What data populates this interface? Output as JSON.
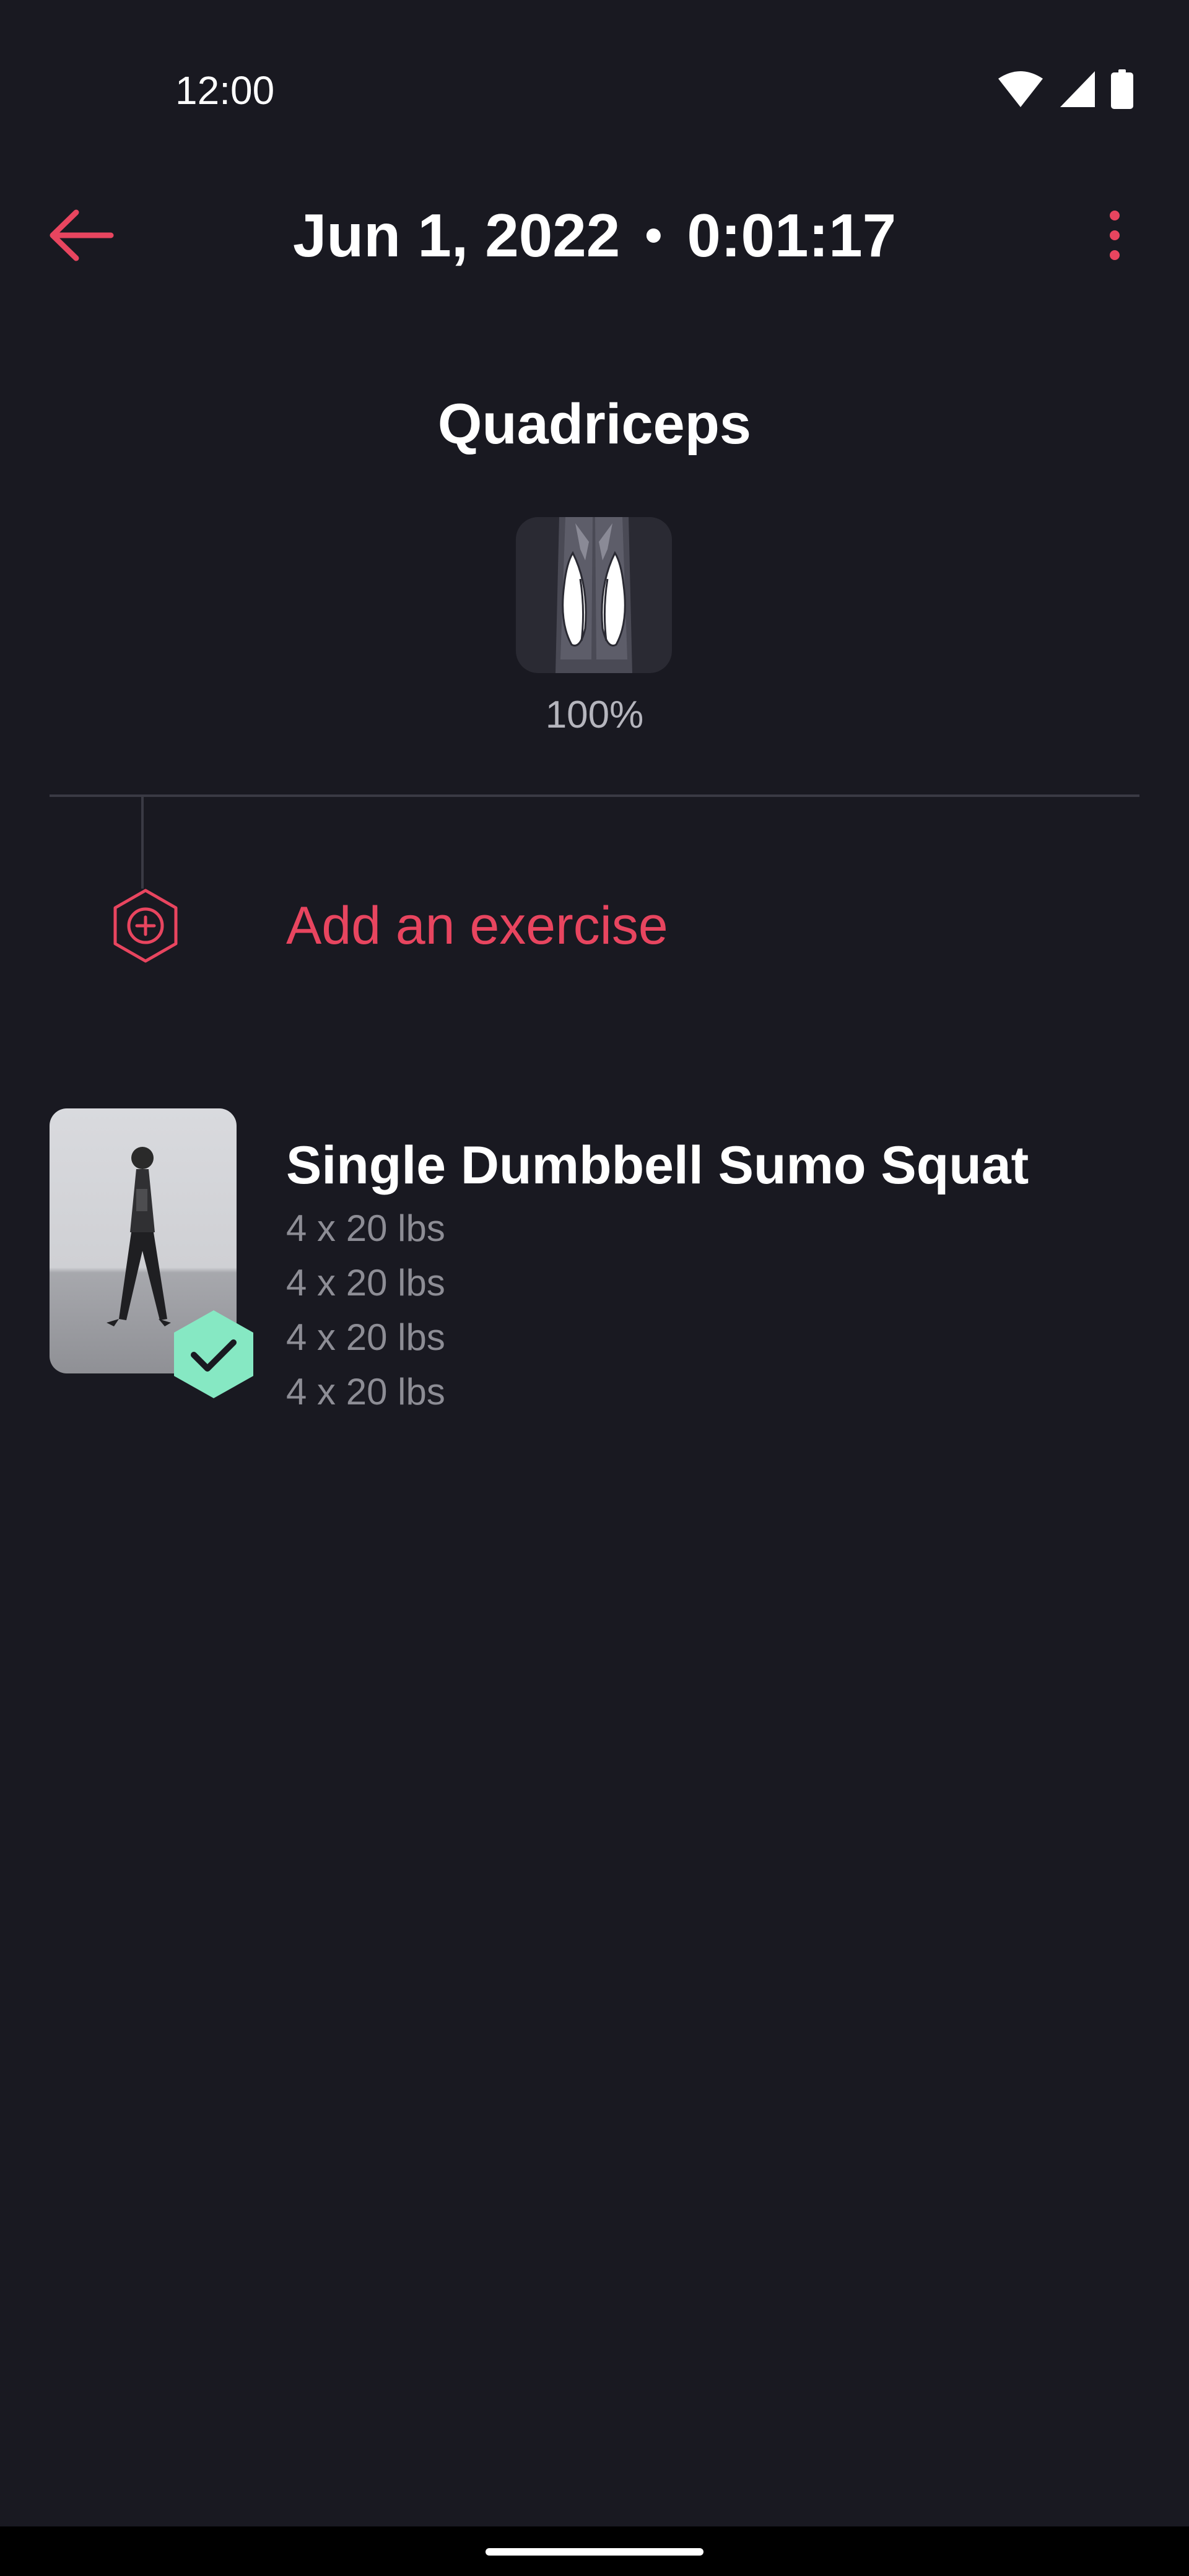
{
  "status_bar": {
    "time": "12:00",
    "icons": [
      "wifi-icon",
      "cellular-signal-icon",
      "battery-icon"
    ]
  },
  "header": {
    "date": "Jun 1, 2022",
    "separator": "•",
    "duration": "0:01:17",
    "back_icon": "arrow-left-icon",
    "menu_icon": "more-vertical-icon"
  },
  "muscle_group": {
    "name": "Quadriceps",
    "percent_label": "100%",
    "percent_value": 100
  },
  "add_exercise": {
    "label": "Add an exercise",
    "icon": "hexagon-plus-icon"
  },
  "exercises": [
    {
      "name": "Single Dumbbell Sumo Squat",
      "completed": true,
      "sets": [
        "4 x 20 lbs",
        "4 x 20 lbs",
        "4 x 20 lbs",
        "4 x 20 lbs"
      ]
    }
  ],
  "colors": {
    "background": "#191921",
    "accent": "#e8455f",
    "success": "#86e8c3",
    "muted_text": "#8d8d95",
    "divider": "#3a3a44"
  }
}
